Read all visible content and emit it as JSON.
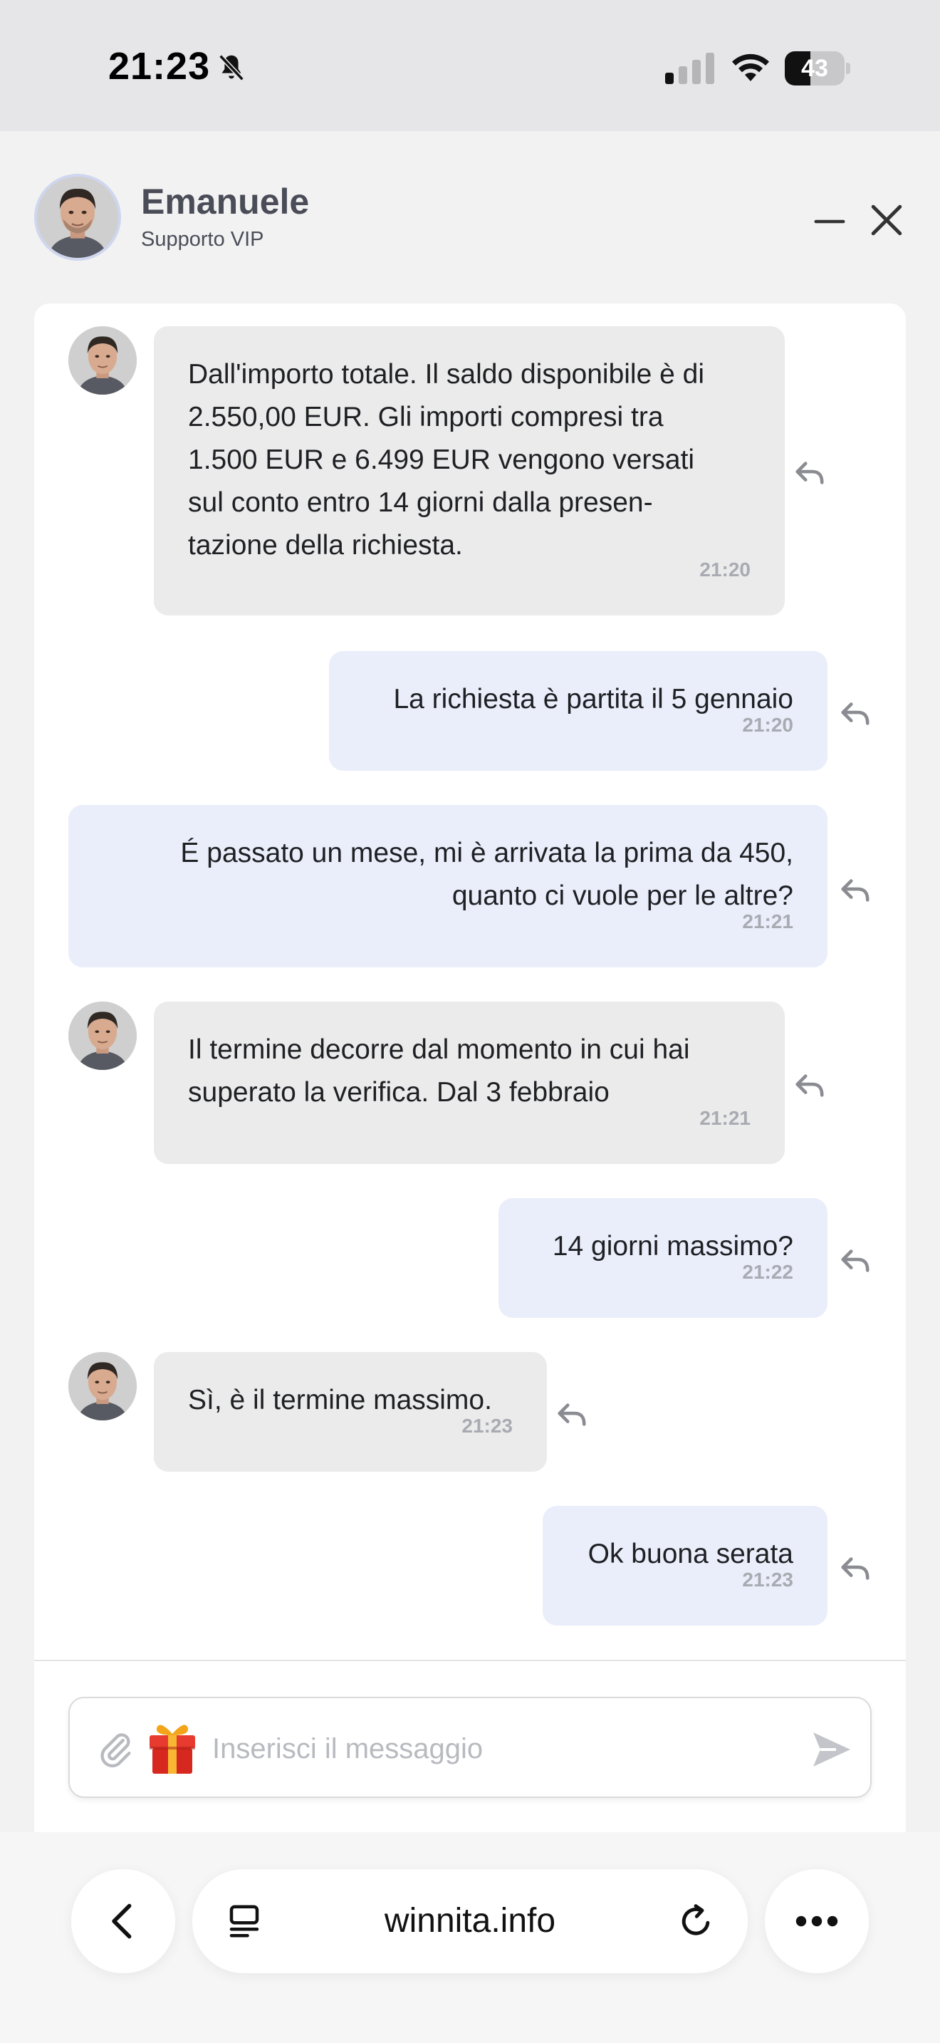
{
  "status_bar": {
    "time": "21:23",
    "battery": "43",
    "battery_level": 0.43,
    "icons": [
      "bell-slash-icon",
      "signal-icon",
      "wifi-icon",
      "battery-icon"
    ]
  },
  "header": {
    "name": "Emanuele",
    "role": "Supporto VIP",
    "icons": [
      "minimize-icon",
      "close-icon"
    ]
  },
  "messages": [
    {
      "sender": "agent",
      "lines": [
        "Dall'importo totale. Il saldo disponibile è di",
        "2.550,00 EUR. Gli importi compresi tra",
        "1.500 EUR e 6.499 EUR vengono versati",
        "sul conto entro 14 giorni dalla presen-",
        "tazione della richiesta."
      ],
      "time": "21:20"
    },
    {
      "sender": "user",
      "lines": [
        "La richiesta è partita il 5 gennaio"
      ],
      "time": "21:20"
    },
    {
      "sender": "user",
      "lines": [
        "É passato un mese, mi è arrivata la prima da 450,",
        "quanto ci vuole per le altre?"
      ],
      "time": "21:21"
    },
    {
      "sender": "agent",
      "lines": [
        "Il termine decorre dal momento in cui hai",
        "superato la verifica. Dal 3 febbraio"
      ],
      "time": "21:21"
    },
    {
      "sender": "user",
      "lines": [
        "14 giorni massimo?"
      ],
      "time": "21:22"
    },
    {
      "sender": "agent",
      "lines": [
        "Sì, è il termine massimo."
      ],
      "time": "21:23"
    },
    {
      "sender": "user",
      "lines": [
        "Ok buona serata"
      ],
      "time": "21:23"
    }
  ],
  "composer": {
    "placeholder": "Inserisci il messaggio",
    "value": "",
    "icons": [
      "paperclip-icon",
      "gift-icon",
      "send-icon"
    ]
  },
  "browser": {
    "url": "winnita.info",
    "icons": [
      "chevron-left-icon",
      "tabs-icon",
      "reload-icon",
      "more-icon"
    ]
  },
  "colors": {
    "agent_bubble": "#ebebeb",
    "user_bubble": "#e9eefa",
    "time_text": "#a9abb2",
    "background": "#f2f2f3"
  }
}
